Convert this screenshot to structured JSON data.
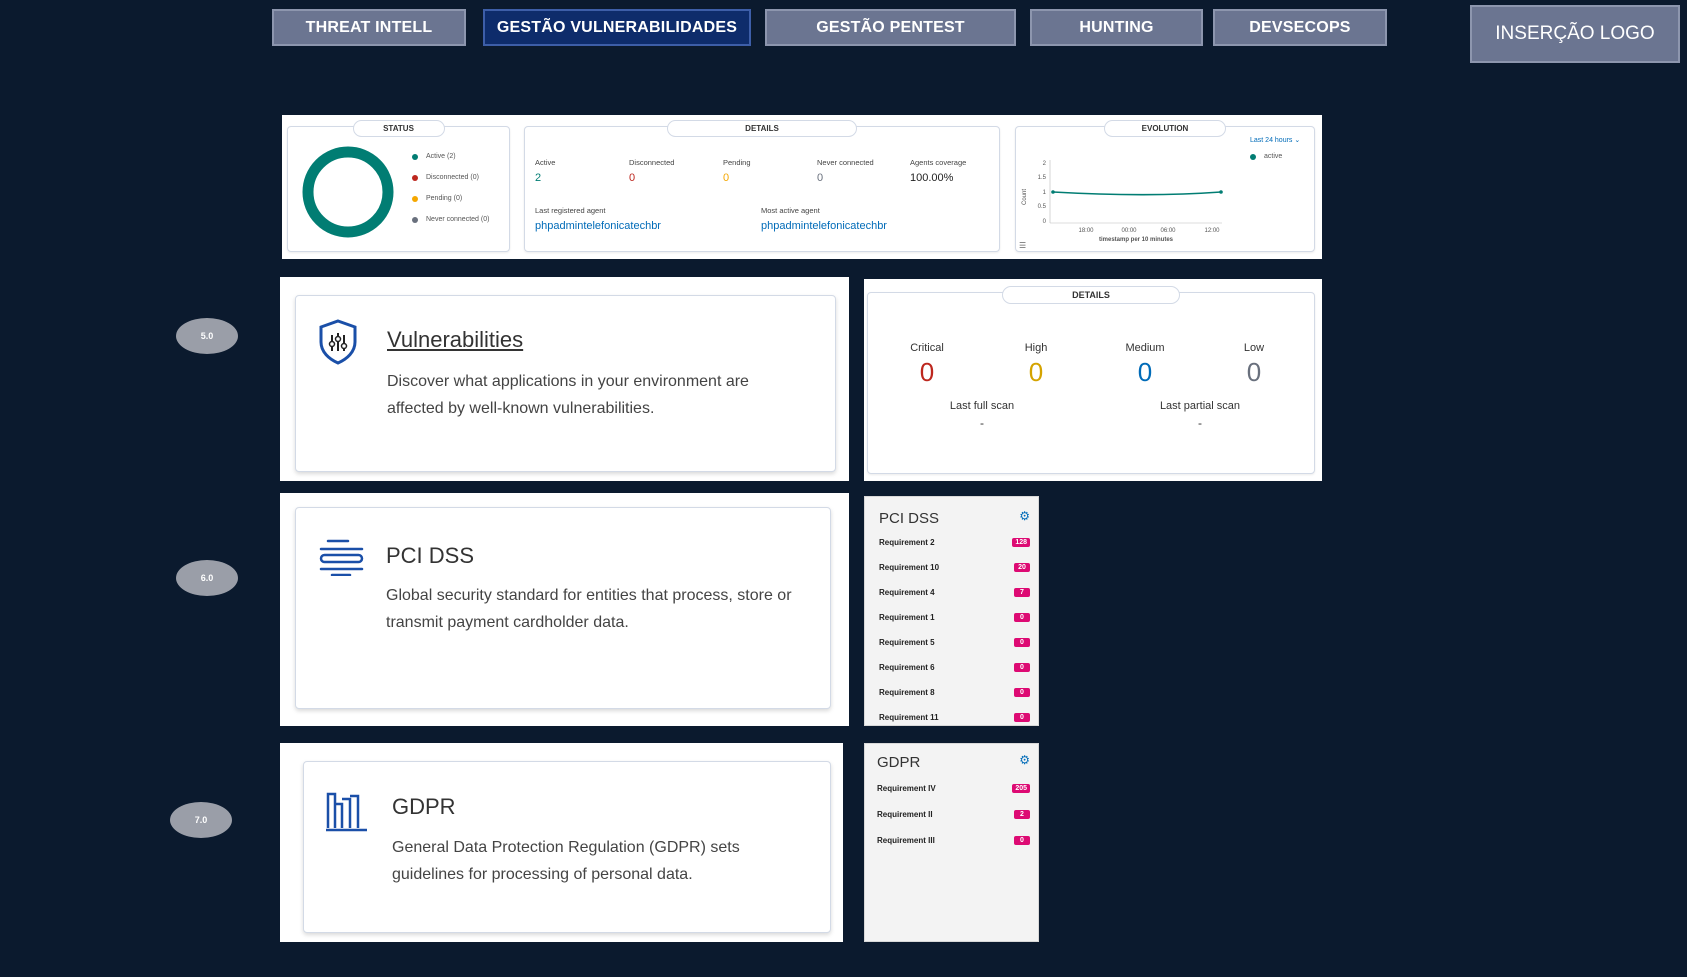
{
  "nav": {
    "tabs": [
      {
        "label": "THREAT INTELL",
        "active": false
      },
      {
        "label": "GESTÃO VULNERABILIDADES",
        "active": true
      },
      {
        "label": "GESTÃO PENTEST",
        "active": false
      },
      {
        "label": "HUNTING",
        "active": false
      },
      {
        "label": "DEVSECOPS",
        "active": false
      }
    ],
    "logo_label": "INSERÇÃO LOGO"
  },
  "status": {
    "title": "STATUS",
    "legend": [
      {
        "label": "Active (2)",
        "color": "#017d73"
      },
      {
        "label": "Disconnected (0)",
        "color": "#bd271e"
      },
      {
        "label": "Pending (0)",
        "color": "#f5a700"
      },
      {
        "label": "Never connected (0)",
        "color": "#69707d"
      }
    ]
  },
  "details": {
    "title": "DETAILS",
    "metrics": [
      {
        "label": "Active",
        "value": "2",
        "color": "#017d73"
      },
      {
        "label": "Disconnected",
        "value": "0",
        "color": "#bd271e"
      },
      {
        "label": "Pending",
        "value": "0",
        "color": "#f5a700"
      },
      {
        "label": "Never connected",
        "value": "0",
        "color": "#69707d"
      },
      {
        "label": "Agents coverage",
        "value": "100.00%",
        "color": "#222222"
      }
    ],
    "last_registered_label": "Last registered agent",
    "last_registered_value": "phpadmintelefonicatechbr",
    "most_active_label": "Most active agent",
    "most_active_value": "phpadmintelefonicatechbr"
  },
  "evolution": {
    "title": "EVOLUTION",
    "range_label": "Last 24 hours",
    "legend_label": "active",
    "y_axis_label": "Count",
    "x_axis_label": "timestamp per 10 minutes",
    "y_ticks": [
      "2",
      "1.5",
      "1",
      "0.5",
      "0"
    ],
    "x_ticks": [
      "18:00",
      "00:00",
      "06:00",
      "12:00"
    ]
  },
  "ovals": [
    "5.0",
    "6.0",
    "7.0"
  ],
  "modules": {
    "vulnerabilities": {
      "title": "Vulnerabilities",
      "description_line1": "Discover what applications in your environment are",
      "description_line2": "affected by well-known vulnerabilities."
    },
    "pci": {
      "title": "PCI DSS",
      "description_line1": "Global security standard for entities that process, store or",
      "description_line2": "transmit payment cardholder data."
    },
    "gdpr": {
      "title": "GDPR",
      "description_line1": "General Data Protection Regulation (GDPR) sets",
      "description_line2": "guidelines for processing of personal data."
    }
  },
  "vuln_details": {
    "title": "DETAILS",
    "severities": [
      {
        "label": "Critical",
        "value": "0",
        "color": "#bd271e"
      },
      {
        "label": "High",
        "value": "0",
        "color": "#d4a300"
      },
      {
        "label": "Medium",
        "value": "0",
        "color": "#006bb8"
      },
      {
        "label": "Low",
        "value": "0",
        "color": "#69707d"
      }
    ],
    "last_full_scan_label": "Last full scan",
    "last_full_scan_value": "-",
    "last_partial_scan_label": "Last partial scan",
    "last_partial_scan_value": "-"
  },
  "pci_list": {
    "title": "PCI DSS",
    "rows": [
      {
        "label": "Requirement 2",
        "count": "128"
      },
      {
        "label": "Requirement 10",
        "count": "20"
      },
      {
        "label": "Requirement 4",
        "count": "7"
      },
      {
        "label": "Requirement 1",
        "count": "0"
      },
      {
        "label": "Requirement 5",
        "count": "0"
      },
      {
        "label": "Requirement 6",
        "count": "0"
      },
      {
        "label": "Requirement 8",
        "count": "0"
      },
      {
        "label": "Requirement 11",
        "count": "0"
      }
    ]
  },
  "gdpr_list": {
    "title": "GDPR",
    "rows": [
      {
        "label": "Requirement IV",
        "count": "205"
      },
      {
        "label": "Requirement II",
        "count": "2"
      },
      {
        "label": "Requirement III",
        "count": "0"
      }
    ]
  }
}
